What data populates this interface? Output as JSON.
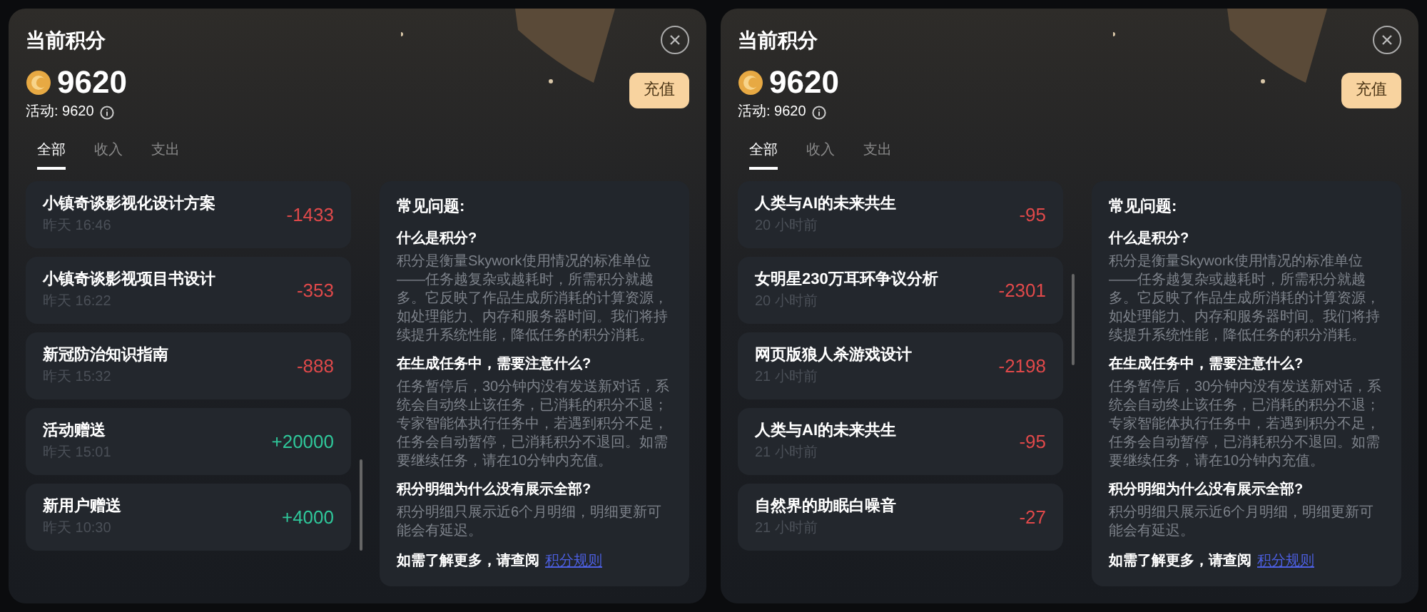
{
  "panels": [
    {
      "title": "当前积分",
      "balance": "9620",
      "activity_label": "活动: 9620",
      "recharge_button": "充值",
      "tabs": [
        {
          "label": "全部",
          "selected": true
        },
        {
          "label": "收入",
          "selected": false
        },
        {
          "label": "支出",
          "selected": false
        }
      ],
      "transactions": [
        {
          "title": "小镇奇谈影视化设计方案",
          "time": "昨天 16:46",
          "amount": "-1433",
          "kind": "expense"
        },
        {
          "title": "小镇奇谈影视项目书设计",
          "time": "昨天 16:22",
          "amount": "-353",
          "kind": "expense"
        },
        {
          "title": "新冠防治知识指南",
          "time": "昨天 15:32",
          "amount": "-888",
          "kind": "expense"
        },
        {
          "title": "活动赠送",
          "time": "昨天 15:01",
          "amount": "+20000",
          "kind": "income"
        },
        {
          "title": "新用户赠送",
          "time": "昨天 10:30",
          "amount": "+4000",
          "kind": "income"
        }
      ],
      "faq": {
        "heading": "常见问题:",
        "items": [
          {
            "question": "什么是积分?",
            "answer": "积分是衡量Skywork使用情况的标准单位——任务越复杂或越耗时，所需积分就越多。它反映了作品生成所消耗的计算资源，如处理能力、内存和服务器时间。我们将持续提升系统性能，降低任务的积分消耗。"
          },
          {
            "question": "在生成任务中，需要注意什么?",
            "answer": "任务暂停后，30分钟内没有发送新对话，系统会自动终止该任务，已消耗的积分不退；专家智能体执行任务中，若遇到积分不足，任务会自动暂停，已消耗积分不退回。如需要继续任务，请在10分钟内充值。"
          },
          {
            "question": "积分明细为什么没有展示全部?",
            "answer": "积分明细只展示近6个月明细，明细更新可能会有延迟。"
          }
        ],
        "footer": "如需了解更多，请查阅",
        "link": "积分规则"
      }
    },
    {
      "title": "当前积分",
      "balance": "9620",
      "activity_label": "活动: 9620",
      "recharge_button": "充值",
      "tabs": [
        {
          "label": "全部",
          "selected": true
        },
        {
          "label": "收入",
          "selected": false
        },
        {
          "label": "支出",
          "selected": false
        }
      ],
      "transactions": [
        {
          "title": "人类与AI的未来共生",
          "time": "20 小时前",
          "amount": "-95",
          "kind": "expense"
        },
        {
          "title": "女明星230万耳环争议分析",
          "time": "20 小时前",
          "amount": "-2301",
          "kind": "expense"
        },
        {
          "title": "网页版狼人杀游戏设计",
          "time": "21 小时前",
          "amount": "-2198",
          "kind": "expense"
        },
        {
          "title": "人类与AI的未来共生",
          "time": "21 小时前",
          "amount": "-95",
          "kind": "expense"
        },
        {
          "title": "自然界的助眠白噪音",
          "time": "21 小时前",
          "amount": "-27",
          "kind": "expense"
        }
      ],
      "faq": {
        "heading": "常见问题:",
        "items": [
          {
            "question": "什么是积分?",
            "answer": "积分是衡量Skywork使用情况的标准单位——任务越复杂或越耗时，所需积分就越多。它反映了作品生成所消耗的计算资源，如处理能力、内存和服务器时间。我们将持续提升系统性能，降低任务的积分消耗。"
          },
          {
            "question": "在生成任务中，需要注意什么?",
            "answer": "任务暂停后，30分钟内没有发送新对话，系统会自动终止该任务，已消耗的积分不退；专家智能体执行任务中，若遇到积分不足，任务会自动暂停，已消耗积分不退回。如需要继续任务，请在10分钟内充值。"
          },
          {
            "question": "积分明细为什么没有展示全部?",
            "answer": "积分明细只展示近6个月明细，明细更新可能会有延迟。"
          }
        ],
        "footer": "如需了解更多，请查阅",
        "link": "积分规则"
      }
    }
  ]
}
